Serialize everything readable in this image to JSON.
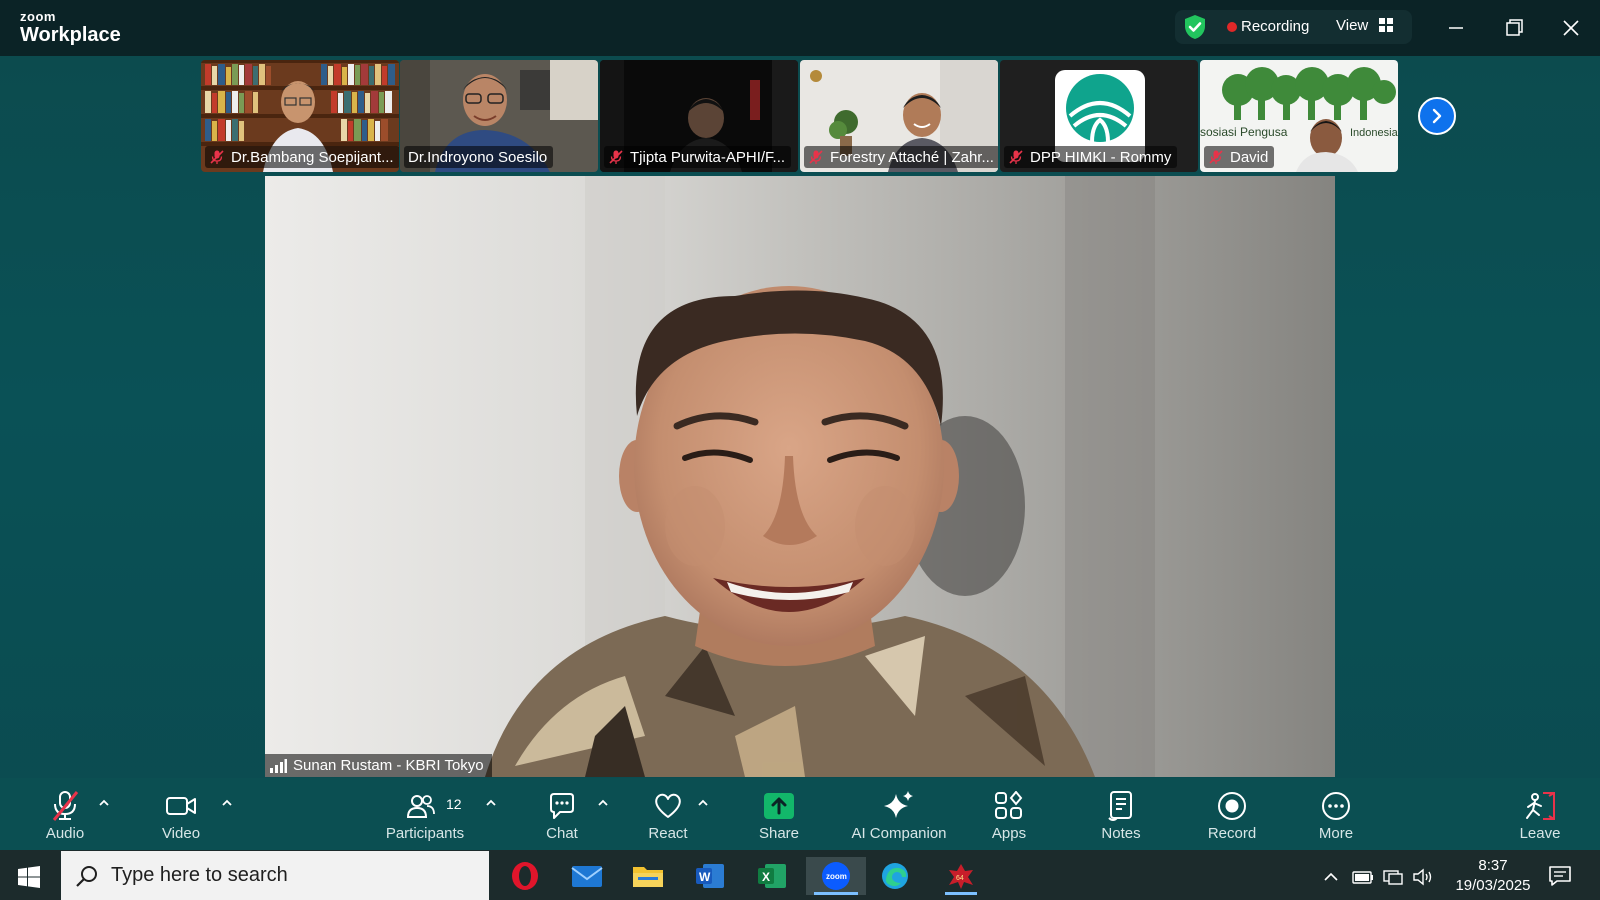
{
  "app": {
    "brand_small": "zoom",
    "brand_large": "Workplace"
  },
  "header": {
    "recording_label": "Recording",
    "view_label": "View"
  },
  "participants_strip": [
    {
      "name": "Dr.Bambang Soepijant...",
      "muted": true
    },
    {
      "name": "Dr.Indroyono Soesilo",
      "muted": false
    },
    {
      "name": "Tjipta Purwita-APHI/F...",
      "muted": true
    },
    {
      "name": "Forestry Attaché | Zahr...",
      "muted": true
    },
    {
      "name": "DPP HIMKI - Rommy",
      "muted": true
    },
    {
      "name": "David",
      "muted": true
    }
  ],
  "thumb_overlay_texts": {
    "apkindo_left": "sosiasi Pengusa",
    "apkindo_right": "Indonesia"
  },
  "main_speaker": {
    "name": "Sunan Rustam - KBRI Tokyo"
  },
  "toolbar": {
    "audio": "Audio",
    "video": "Video",
    "participants": "Participants",
    "participants_count": "12",
    "chat": "Chat",
    "react": "React",
    "share": "Share",
    "ai_companion": "AI Companion",
    "apps": "Apps",
    "notes": "Notes",
    "record": "Record",
    "more": "More",
    "leave": "Leave"
  },
  "taskbar": {
    "search_placeholder": "Type here to search",
    "time": "8:37",
    "date": "19/03/2025",
    "apps": [
      "opera-icon",
      "mail-icon",
      "file-explorer-icon",
      "word-icon",
      "excel-icon",
      "zoom-icon",
      "edge-icon",
      "game-icon"
    ]
  },
  "colors": {
    "accent_blue": "#0e72ed",
    "share_green": "#12b76a",
    "record_red": "#e02828",
    "mute_red": "#e8334a",
    "background": "#0a5156"
  }
}
